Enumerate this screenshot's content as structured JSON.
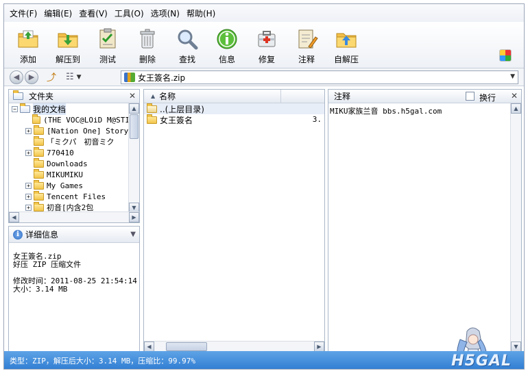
{
  "menu": [
    "文件(F)",
    "编辑(E)",
    "查看(V)",
    "工具(O)",
    "选项(N)",
    "帮助(H)"
  ],
  "toolbar": [
    {
      "label": "添加",
      "icon": "add-folder-icon"
    },
    {
      "label": "解压到",
      "icon": "extract-folder-icon"
    },
    {
      "label": "测试",
      "icon": "test-checklist-icon"
    },
    {
      "label": "删除",
      "icon": "trash-icon"
    },
    {
      "label": "查找",
      "icon": "magnifier-icon"
    },
    {
      "label": "信息",
      "icon": "info-icon"
    },
    {
      "label": "修复",
      "icon": "repair-kit-icon"
    },
    {
      "label": "注释",
      "icon": "comment-note-icon"
    },
    {
      "label": "自解压",
      "icon": "self-extract-icon"
    }
  ],
  "address": {
    "value": "女王簽名.zip"
  },
  "folders": {
    "title": "文件夹",
    "root": "我的文档",
    "items": [
      {
        "label": "(THE VOC@LOiD M@STI",
        "expandable": false
      },
      {
        "label": "[Nation One] Story",
        "expandable": true
      },
      {
        "label": "「ミクパ　初音ミク",
        "expandable": false
      },
      {
        "label": "770410",
        "expandable": true
      },
      {
        "label": "Downloads",
        "expandable": false
      },
      {
        "label": "MIKUMIKU",
        "expandable": false
      },
      {
        "label": "My Games",
        "expandable": true
      },
      {
        "label": "Tencent Files",
        "expandable": true
      },
      {
        "label": "初音[内含2包",
        "expandable": true
      }
    ]
  },
  "details": {
    "title": "详细信息",
    "filename": "女王簽名.zip",
    "filetype": "好压 ZIP 压缩文件",
    "modified": "修改时间：2011-08-25 21:54:14",
    "size": "大小：3.14 MB"
  },
  "filelist": {
    "column_name": "名称",
    "rows": [
      {
        "name": "..(上层目录)",
        "size": ""
      },
      {
        "name": "女王簽名",
        "size": "3."
      }
    ]
  },
  "comment": {
    "title": "注释",
    "wrap_label": "换行",
    "text": "MIKU家族兰音 bbs.h5gal.com"
  },
  "status": "类型：ZIP，解压后大小：3.14 MB，压缩比：99.97%",
  "logo": "H5GAL"
}
